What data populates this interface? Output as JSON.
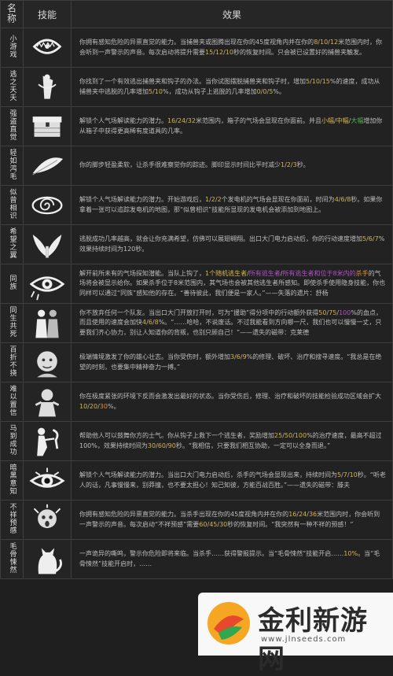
{
  "header": {
    "col_name": "名称",
    "col_skill": "技能",
    "col_effect": "效果"
  },
  "rows": [
    {
      "name": "小游戏",
      "icon": "bear-trap-icon",
      "desc": [
        "你拥有感知危险的异禀直觉的能力。当捕兽夹或图腾出现在你的45度视角内并在你的",
        {
          "c": "y",
          "t": "8"
        },
        "/",
        {
          "c": "y",
          "t": "10"
        },
        "/",
        {
          "c": "y",
          "t": "12"
        },
        "米范围内时，你会听到一声警示的声音。每次启动将提升需要",
        {
          "c": "y",
          "t": "15"
        },
        "/",
        {
          "c": "y",
          "t": "12"
        },
        "/",
        {
          "c": "y",
          "t": "10"
        },
        "秒的恢复时间。只会被已设置好的捕兽夹触发。"
      ]
    },
    {
      "name": "逃之夭夭",
      "icon": "trap-escape-icon",
      "desc": [
        "你找到了一个有效逃出捕兽夹和钩子的办法。当你试图摆脱捕兽夹和钩子时，增加",
        {
          "c": "y",
          "t": "5"
        },
        "/",
        {
          "c": "y",
          "t": "10"
        },
        "/",
        {
          "c": "y",
          "t": "15"
        },
        "%的速度，成功从捕兽夹中逃脱的几率增加",
        {
          "c": "y",
          "t": "5"
        },
        "/",
        {
          "c": "y",
          "t": "10"
        },
        "%，成功从钩子上逃脱的几率增加",
        {
          "c": "y",
          "t": "0"
        },
        "/",
        {
          "c": "y",
          "t": "0"
        },
        "/",
        {
          "c": "y",
          "t": "5"
        },
        "%。"
      ]
    },
    {
      "name": "强盗直觉",
      "icon": "chest-icon",
      "desc": [
        "解锁个人气场解读能力的潜力。",
        {
          "c": "y",
          "t": "16"
        },
        "/",
        {
          "c": "y",
          "t": "24"
        },
        "/",
        {
          "c": "y",
          "t": "32"
        },
        "米范围内，箱子的气场会显现在你面前。并且",
        {
          "c": "y",
          "t": "小幅"
        },
        "/",
        {
          "c": "y",
          "t": "中幅"
        },
        "/",
        {
          "c": "g",
          "t": "大幅"
        },
        "增加你从箱子中获得更高稀有度道具的几率。"
      ]
    },
    {
      "name": "轻如鸿毛",
      "icon": "feather-icon",
      "desc": [
        "你的脚步轻盈柔软，让杀手很难察觉你的踪迹。脚印显示时间比平时减少",
        {
          "c": "y",
          "t": "1"
        },
        "/",
        {
          "c": "y",
          "t": "2"
        },
        "/",
        {
          "c": "y",
          "t": "3"
        },
        "秒。"
      ]
    },
    {
      "name": "似曾相识",
      "icon": "swirl-icon",
      "desc": [
        "解锁个人气场解读能力的潜力。开始游戏后，",
        {
          "c": "y",
          "t": "1"
        },
        "/",
        {
          "c": "y",
          "t": "2"
        },
        "/",
        {
          "c": "y",
          "t": "2"
        },
        "个发电机的气场会显现在你面前，时间为",
        {
          "c": "y",
          "t": "4"
        },
        "/",
        {
          "c": "y",
          "t": "6"
        },
        "/",
        {
          "c": "y",
          "t": "8"
        },
        "秒。如果你拿着一张可以追踪发电机的地图，那“似曾相识”技能所显现的发电机会被添加到地图上。"
      ]
    },
    {
      "name": "希望之翼",
      "icon": "wings-icon",
      "desc": [
        "逃脱成功几率越高，就会让你充满希望，仿佛可以展翅翱翔。出口大门电力启动后，你的行动速度增加",
        {
          "c": "y",
          "t": "5"
        },
        "/",
        {
          "c": "y",
          "t": "6"
        },
        "/",
        {
          "c": "y",
          "t": "7"
        },
        "%效果持续时间为120秒。"
      ]
    },
    {
      "name": "同族",
      "icon": "eye-icon",
      "desc": [
        "解开前所未有的气场探知潜能。当队上钩了，",
        {
          "c": "y",
          "t": "1个随机逃生者"
        },
        "/",
        {
          "c": "p",
          "t": "所有逃生者"
        },
        "/",
        {
          "c": "p",
          "t": "所有逃生者和位于8米内的"
        },
        {
          "c": "o",
          "t": "杀手"
        },
        "的气场将会被显示给你。如果杀手位于8米范围内，其气场也会被其他逃生者所感知。即使杀手使用隐身技能，你也同样可以通过“同族”感知他的存在。“善待彼此，我们便是一家人。”——失落的遗片：舒杨"
      ]
    },
    {
      "name": "同生共死",
      "icon": "together-icon",
      "desc": [
        "你不放弃任何一个队友。当出口大门开放打开时，可为“援助”得分项中的行动额外获得",
        {
          "c": "y",
          "t": "50"
        },
        "/",
        {
          "c": "y",
          "t": "75"
        },
        "/",
        {
          "c": "p",
          "t": "100"
        },
        "%的血点，而且使用的速度会加快",
        {
          "c": "y",
          "t": "4"
        },
        "/",
        {
          "c": "y",
          "t": "6"
        },
        "/",
        {
          "c": "y",
          "t": "8"
        },
        "%。“……哈哈，不说废话。不过我能看到方向哪一尺，我们也可以慢慢一丈，只要我们齐心协力，别让人知道你的背叛，也别只顾自己！”——遗失的磁带：克莱德"
      ]
    },
    {
      "name": "百折不挠",
      "icon": "face-icon",
      "desc": [
        "极端情境激发了你的雄心壮志。当你受伤时，额外增加",
        {
          "c": "y",
          "t": "3"
        },
        "/",
        {
          "c": "y",
          "t": "6"
        },
        "/",
        {
          "c": "y",
          "t": "9"
        },
        "%的修理、破坏、治疗和搜寻速度。“我总是在绝望的时刻，也要集中精神奋力一搏。”"
      ]
    },
    {
      "name": "难以置信",
      "icon": "survivor-icon",
      "desc": [
        "你在极度紧张的环境下反而会激发出最好的状态。当你受伤后，修理、治疗和破坏的技能检验成功区域会扩大",
        {
          "c": "y",
          "t": "10"
        },
        "/",
        {
          "c": "y",
          "t": "20"
        },
        "/",
        {
          "c": "o",
          "t": "30"
        },
        "%。"
      ]
    },
    {
      "name": "马到成功",
      "icon": "helper-icon",
      "desc": [
        "帮助他人可以鼓舞你方的士气。你从钩子上救下一个逃生者，奖励增加",
        {
          "c": "y",
          "t": "25"
        },
        "/",
        {
          "c": "y",
          "t": "50"
        },
        "/",
        {
          "c": "y",
          "t": "100"
        },
        "%的治疗速度，最高不超过100%，效果持续时间为",
        {
          "c": "y",
          "t": "30"
        },
        "/",
        {
          "c": "y",
          "t": "60"
        },
        "/",
        {
          "c": "y",
          "t": "90"
        },
        "秒。“我相信，只要我们相互协助，一定可以全身而退。”"
      ]
    },
    {
      "name": "暗黑意知",
      "icon": "dark-eye-icon",
      "desc": [
        "解锁个人气场解读能力的潜力。当出口大门电力启动后，杀手的气场会显现出来，持续时间为",
        {
          "c": "y",
          "t": "5"
        },
        "/",
        {
          "c": "y",
          "t": "7"
        },
        "/",
        {
          "c": "y",
          "t": "10"
        },
        "秒。“听老人的话，凡事慢慢来，别莽撞，也不要太担心！知己知彼，方能百战百胜。”——遗失的磁带：滕夫"
      ]
    },
    {
      "name": "不祥预感",
      "icon": "scared-icon",
      "desc": [
        "你拥有感知危险的异禀直觉的能力。当杀手出现在你的45度视角内并在你的",
        {
          "c": "y",
          "t": "16"
        },
        "/",
        {
          "c": "y",
          "t": "24"
        },
        "/",
        {
          "c": "y",
          "t": "36"
        },
        "米范围内时，你会听到一声警示的声音。每次启动“不祥预感”需要",
        {
          "c": "y",
          "t": "60"
        },
        "/",
        {
          "c": "y",
          "t": "45"
        },
        "/",
        {
          "c": "y",
          "t": "30"
        },
        "秒的恢复时间。“我突然有一种不祥的预感！”"
      ]
    },
    {
      "name": "毛骨悚然",
      "icon": "cat-icon",
      "desc": [
        "一声诡异的嘶鸣，警示你危险即将来临。当杀手……获得警报提示。当“毛骨悚然”技能开启……",
        {
          "c": "y",
          "t": "10%"
        },
        "。当“毛骨悚然”技能开启时，……"
      ]
    }
  ],
  "watermark": {
    "title": "金利新游网",
    "url": "www.jlnseeds.com"
  }
}
